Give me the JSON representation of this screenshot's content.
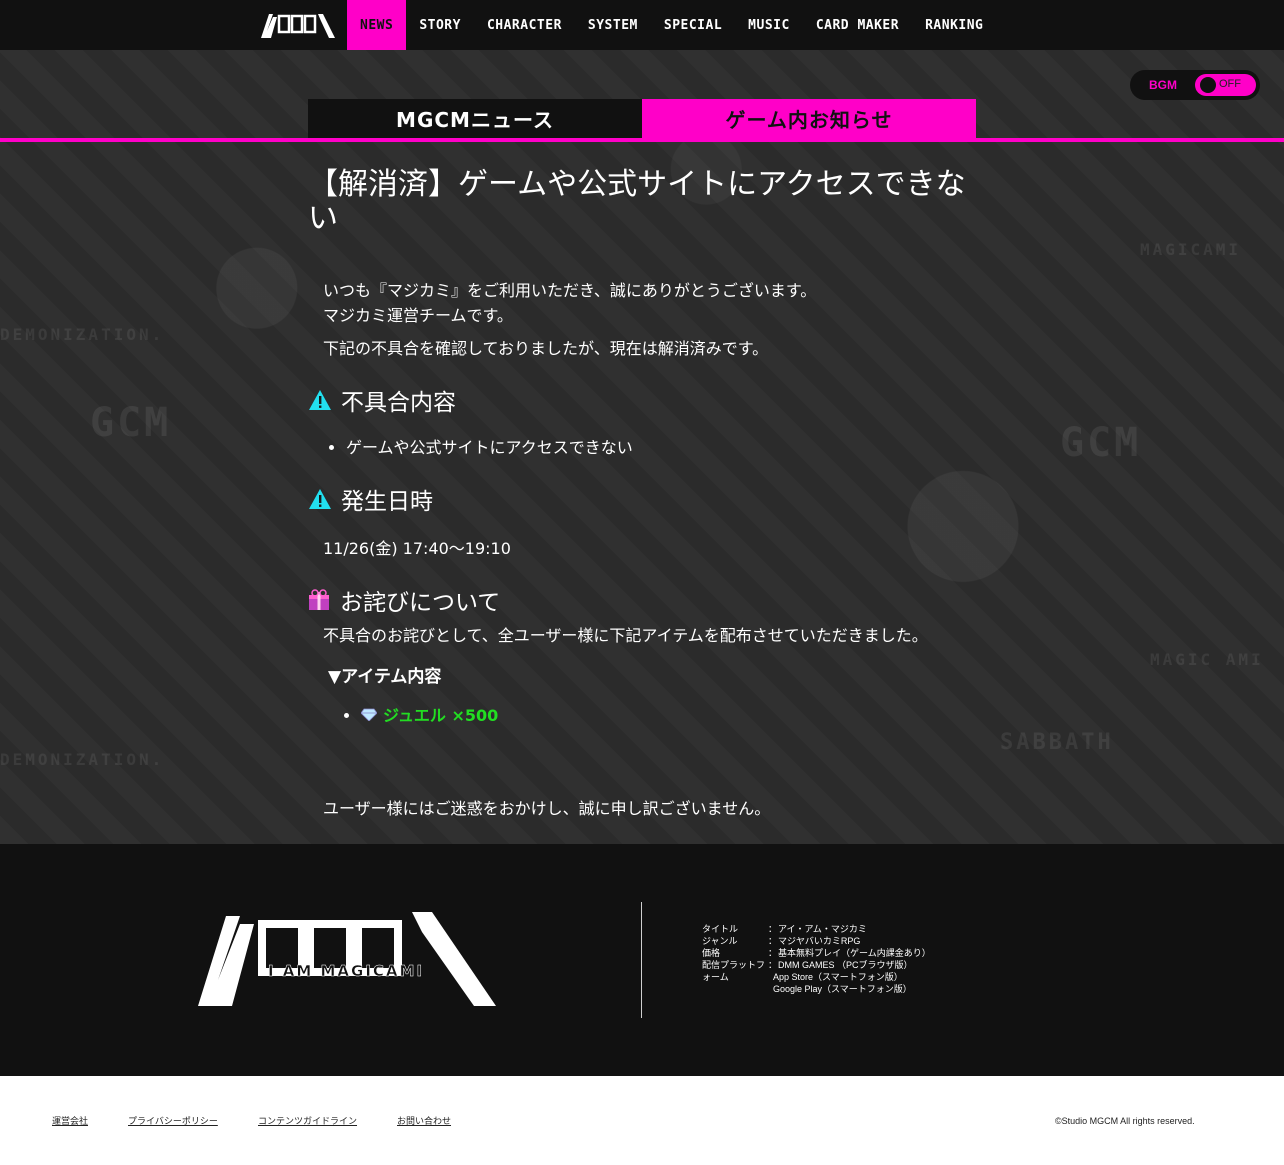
{
  "nav": {
    "logo_text": "I AM MAGICAMI",
    "items": [
      "NEWS",
      "STORY",
      "CHARACTER",
      "SYSTEM",
      "SPECIAL",
      "MUSIC",
      "CARD MAKER",
      "RANKING"
    ]
  },
  "bgm": {
    "label": "BGM",
    "state": "OFF"
  },
  "tabs": {
    "news": "MGCMニュース",
    "game": "ゲーム内お知らせ"
  },
  "article": {
    "title": "【解消済】ゲームや公式サイトにアクセスできない",
    "intro1": "いつも『マジカミ』をご利用いただき、誠にありがとうございます。",
    "intro2": "マジカミ運営チームです。",
    "intro3": "下記の不具合を確認しておりましたが、現在は解消済みです。",
    "section1": {
      "heading": "不具合内容",
      "items": [
        "ゲームや公式サイトにアクセスできない"
      ]
    },
    "section2": {
      "heading": "発生日時",
      "text": "11/26(金) 17:40～19:10"
    },
    "section3": {
      "heading": "お詫びについて",
      "text": "不具合のお詫びとして、全ユーザー様に下記アイテムを配布させていただきました。",
      "sub_heading": "▼アイテム内容",
      "items": [
        "ジュエル ×500"
      ]
    },
    "closing": "ユーザー様にはご迷惑をおかけし、誠に申し訳ございません。"
  },
  "footer": {
    "logo_text": "I AM MAGICAMI",
    "info": [
      {
        "key": "タイトル",
        "val": "アイ・アム・マジカミ"
      },
      {
        "key": "ジャンル",
        "val": "マジヤバいカミRPG"
      },
      {
        "key": "価格",
        "val": "基本無料プレイ（ゲーム内課金あり）"
      },
      {
        "key": "配信プラットフ",
        "val": " DMM GAMES （PCブラウザ版）"
      }
    ],
    "info_extra": [
      "ォーム",
      "App Store（スマートフォン版）",
      "Google Play（スマートフォン版）"
    ],
    "links": [
      "運営会社",
      "プライバシーポリシー",
      "コンテンツガイドライン",
      "お問い合わせ"
    ],
    "copyright": "©Studio MGCM All rights reserved."
  },
  "colors": {
    "accent": "#ff00c8",
    "dark": "#111111",
    "jewel": "#22dd22",
    "warn": "#22e0f0"
  }
}
